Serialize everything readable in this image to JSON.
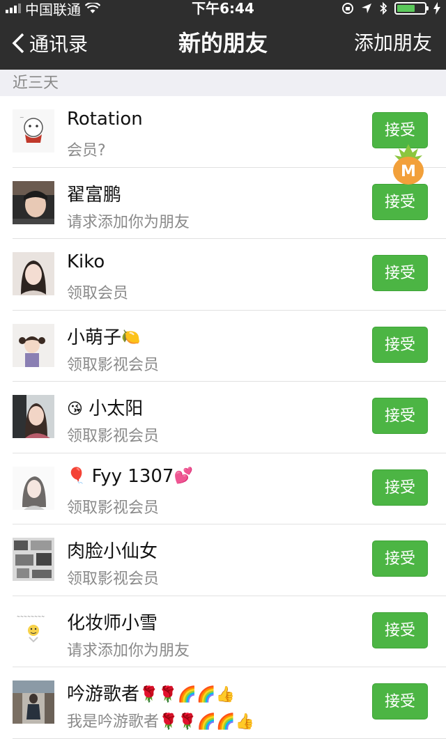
{
  "status_bar": {
    "carrier": "中国联通",
    "time": "下午6:44"
  },
  "nav": {
    "back_label": "通讯录",
    "title": "新的朋友",
    "action_label": "添加朋友"
  },
  "section": {
    "header": "近三天"
  },
  "requests": [
    {
      "name": "Rotation",
      "name_emoji": [],
      "name_prefix_emoji": "",
      "message": "会员?",
      "message_emoji": [],
      "accept_label": "接受",
      "avatar": "cartoon-doodle"
    },
    {
      "name": "翟富鹏",
      "name_emoji": [],
      "name_prefix_emoji": "",
      "message": "请求添加你为朋友",
      "message_emoji": [],
      "accept_label": "接受",
      "avatar": "photo-person-dark"
    },
    {
      "name": "Kiko",
      "name_emoji": [],
      "name_prefix_emoji": "",
      "message": "领取会员",
      "message_emoji": [],
      "accept_label": "接受",
      "avatar": "photo-woman"
    },
    {
      "name": "小萌子",
      "name_emoji": [
        "🍋"
      ],
      "name_prefix_emoji": "",
      "message": "领取影视会员",
      "message_emoji": [],
      "accept_label": "接受",
      "avatar": "photo-child"
    },
    {
      "name": "小太阳",
      "name_emoji": [],
      "name_prefix_emoji": "😘",
      "message": "领取影视会员",
      "message_emoji": [],
      "accept_label": "接受",
      "avatar": "photo-woman-2"
    },
    {
      "name": "Fyy 1307",
      "name_emoji": [
        "💕"
      ],
      "name_prefix_emoji": "🎈",
      "message": "领取影视会员",
      "message_emoji": [],
      "accept_label": "接受",
      "avatar": "photo-girl-light"
    },
    {
      "name": "肉脸小仙女",
      "name_emoji": [],
      "name_prefix_emoji": "",
      "message": "领取影视会员",
      "message_emoji": [],
      "accept_label": "接受",
      "avatar": "collage-gray"
    },
    {
      "name": "化妆师小雪",
      "name_emoji": [],
      "name_prefix_emoji": "",
      "message": "请求添加你为朋友",
      "message_emoji": [],
      "accept_label": "接受",
      "avatar": "cartoon-smiley"
    },
    {
      "name": "吟游歌者",
      "name_emoji": [
        "🌹",
        "🌹",
        "🌈",
        "🌈",
        "👍"
      ],
      "name_prefix_emoji": "",
      "message": "我是吟游歌者",
      "message_emoji": [
        "🌹",
        "🌹",
        "🌈",
        "🌈",
        "👍"
      ],
      "accept_label": "接受",
      "avatar": "photo-man-street"
    }
  ],
  "overlay_badge": {
    "letter": "M",
    "color": "#f2a03a",
    "leaf_color": "#8cc63f"
  },
  "colors": {
    "nav_bg": "#2e2e2e",
    "accept_bg": "#4cb544",
    "section_bg": "#efeff4"
  }
}
